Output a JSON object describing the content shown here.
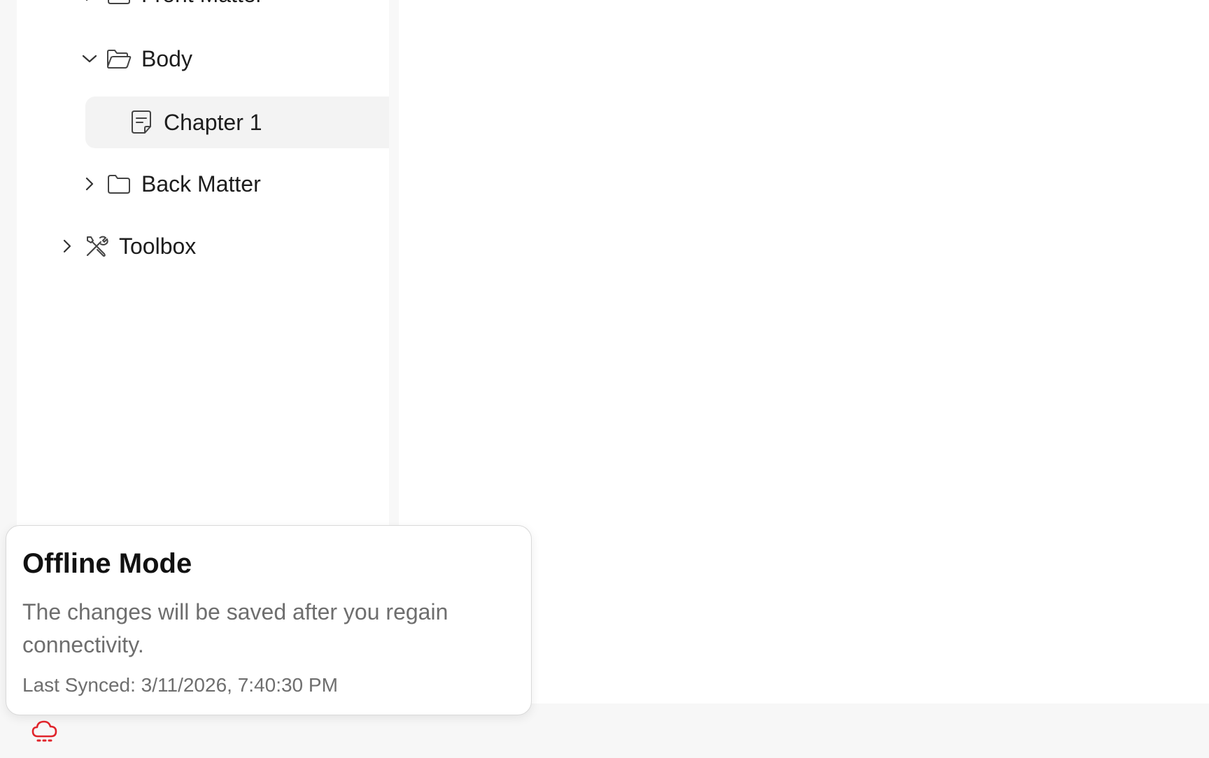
{
  "sidebar": {
    "items": [
      {
        "label": "Front Matter",
        "icon": "folder-icon",
        "chevron": "chevron-right-icon"
      },
      {
        "label": "Body",
        "icon": "folder-open-icon",
        "chevron": "chevron-down-icon"
      },
      {
        "label": "Chapter 1",
        "icon": "document-icon",
        "selected": true
      },
      {
        "label": "Back Matter",
        "icon": "folder-icon",
        "chevron": "chevron-right-icon"
      },
      {
        "label": "Toolbox",
        "icon": "tools-icon",
        "chevron": "chevron-right-icon"
      }
    ]
  },
  "offline_popover": {
    "title": "Offline Mode",
    "message": "The changes will be saved after you regain connectivity.",
    "last_synced": "Last Synced: 3/11/2026, 7:40:30 PM"
  },
  "status_bar": {
    "offline_icon": "cloud-offline-icon",
    "offline_color": "#e0242b"
  },
  "colors": {
    "selected_row_bg": "#f3f3f3",
    "muted_text": "#6e6e6e"
  }
}
